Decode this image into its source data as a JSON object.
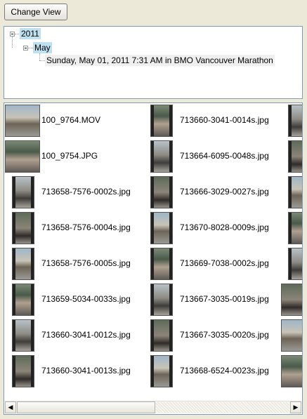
{
  "toolbar": {
    "change_view_label": "Change View"
  },
  "tree": {
    "year": "2011",
    "month": "May",
    "event": "Sunday, May 01, 2011 7:31 AM in BMO Vancouver Marathon"
  },
  "files": {
    "col1": [
      {
        "name": "100_9764.MOV",
        "kind": "landscape"
      },
      {
        "name": "100_9754.JPG",
        "kind": "landscape"
      },
      {
        "name": "713658-7576-0002s.jpg",
        "kind": "portrait"
      },
      {
        "name": "713658-7576-0004s.jpg",
        "kind": "portrait"
      },
      {
        "name": "713658-7576-0005s.jpg",
        "kind": "portrait"
      },
      {
        "name": "713659-5034-0033s.jpg",
        "kind": "portrait"
      },
      {
        "name": "713660-3041-0012s.jpg",
        "kind": "portrait"
      },
      {
        "name": "713660-3041-0013s.jpg",
        "kind": "portrait"
      }
    ],
    "col2": [
      {
        "name": "713660-3041-0014s.jpg",
        "kind": "portrait"
      },
      {
        "name": "713664-6095-0048s.jpg",
        "kind": "portrait"
      },
      {
        "name": "713666-3029-0027s.jpg",
        "kind": "portrait"
      },
      {
        "name": "713670-8028-0009s.jpg",
        "kind": "portrait"
      },
      {
        "name": "713669-7038-0002s.jpg",
        "kind": "portrait"
      },
      {
        "name": "713667-3035-0019s.jpg",
        "kind": "portrait"
      },
      {
        "name": "713667-3035-0020s.jpg",
        "kind": "portrait"
      },
      {
        "name": "713668-6524-0023s.jpg",
        "kind": "portrait"
      }
    ],
    "col3_kinds": [
      "portrait",
      "portrait",
      "portrait",
      "portrait",
      "portrait",
      "landscape",
      "landscape",
      "landscape"
    ]
  },
  "scrollbar": {
    "left_arrow": "◀",
    "right_arrow": "▶"
  }
}
